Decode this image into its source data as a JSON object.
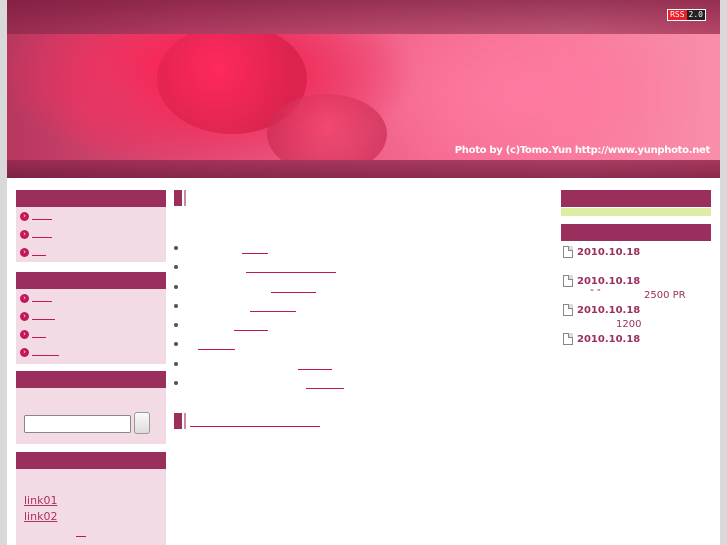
{
  "header": {
    "photo_credit": "Photo by (c)Tomo.Yun http://www.yunphoto.net",
    "rss_badge": {
      "left": "RSS",
      "right": "2.0"
    }
  },
  "sidebar": {
    "links": {
      "link01": "link01",
      "link02": "link02"
    }
  },
  "right": {
    "entries": [
      {
        "date": "2010.10.18"
      },
      {
        "date": "2010.10.18",
        "note": "“ ”",
        "note2": "2500 PR"
      },
      {
        "date": "2010.10.18",
        "note": "1200"
      },
      {
        "date": "2010.10.18"
      }
    ]
  },
  "colors": {
    "accent": "#9a2f5e",
    "box_bg": "#f2dbe4",
    "link": "#c2185b",
    "green_strip": "#dceea4"
  }
}
